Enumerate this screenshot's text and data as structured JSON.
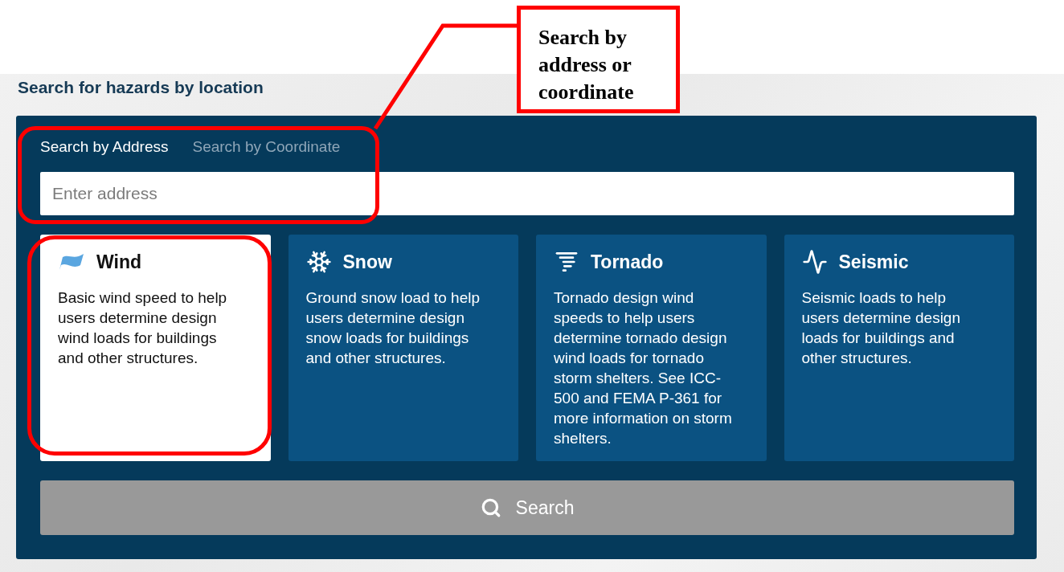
{
  "heading": "Search for hazards by location",
  "tabs": [
    {
      "label": "Search by Address",
      "selected": true
    },
    {
      "label": "Search by Coordinate",
      "selected": false
    }
  ],
  "search": {
    "placeholder": "Enter address"
  },
  "hazards": [
    {
      "kind": "wind",
      "title": "Wind",
      "description": "Basic wind speed to help users determine design wind loads for buildings and other structures.",
      "selected": true
    },
    {
      "kind": "snow",
      "title": "Snow",
      "description": "Ground snow load to help users determine design snow loads for buildings and other structures.",
      "selected": false
    },
    {
      "kind": "tornado",
      "title": "Tornado",
      "description": "Tornado design wind speeds to help users determine tornado design wind loads for tornado storm shelters. See ICC-500 and FEMA P-361 for more information on storm shelters.",
      "selected": false
    },
    {
      "kind": "seismic",
      "title": "Seismic",
      "description": "Seismic loads to help users determine design loads for buildings and other structures.",
      "selected": false
    }
  ],
  "search_button": {
    "label": "Search",
    "disabled": true
  },
  "callout": {
    "text": "Search by address or coordinate"
  }
}
